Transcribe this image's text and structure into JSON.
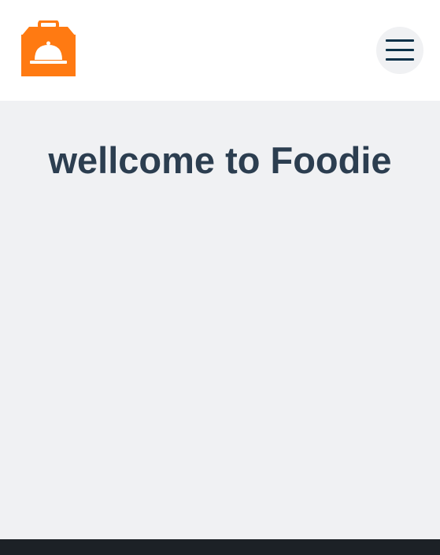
{
  "header": {
    "logo_icon": "food-delivery-box-icon",
    "menu_icon": "hamburger-menu-icon"
  },
  "main": {
    "title": "wellcome to Foodie"
  },
  "colors": {
    "brand_orange": "#ff7a12",
    "header_bg": "#ffffff",
    "main_bg": "#f0f1f3",
    "title_text": "#2c3e50",
    "menu_bar": "#0b3148",
    "footer_bg": "#1c2126"
  }
}
